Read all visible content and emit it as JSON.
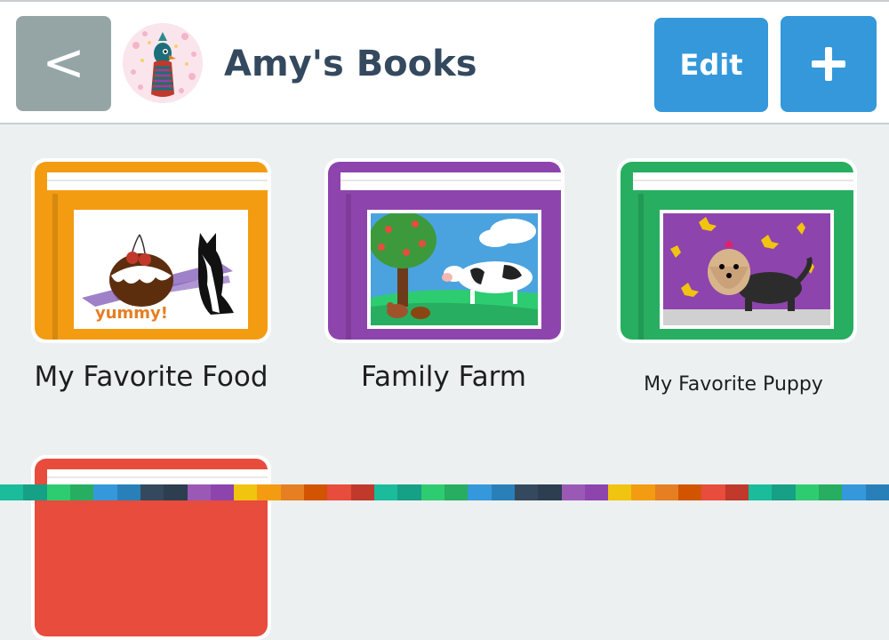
{
  "header": {
    "back_label": "<",
    "title": "Amy's Books",
    "edit_label": "Edit"
  },
  "books": [
    {
      "title": "My Favorite Food",
      "cover_color": "#f39c12",
      "cover_dark": "#d68910",
      "cover_text": "yummy!"
    },
    {
      "title": "Family Farm",
      "cover_color": "#8e44ad",
      "cover_dark": "#7d3c98"
    },
    {
      "title": "My Favorite Puppy",
      "cover_color": "#27ae60",
      "cover_dark": "#229954"
    },
    {
      "title": "",
      "cover_color": "#e74c3c",
      "cover_dark": "#cb4335"
    }
  ],
  "colors": {
    "header_bg": "#ffffff",
    "content_bg": "#ecf0f1",
    "back_button": "#95a5a6",
    "primary_button": "#3498db",
    "title_text": "#34495e"
  }
}
